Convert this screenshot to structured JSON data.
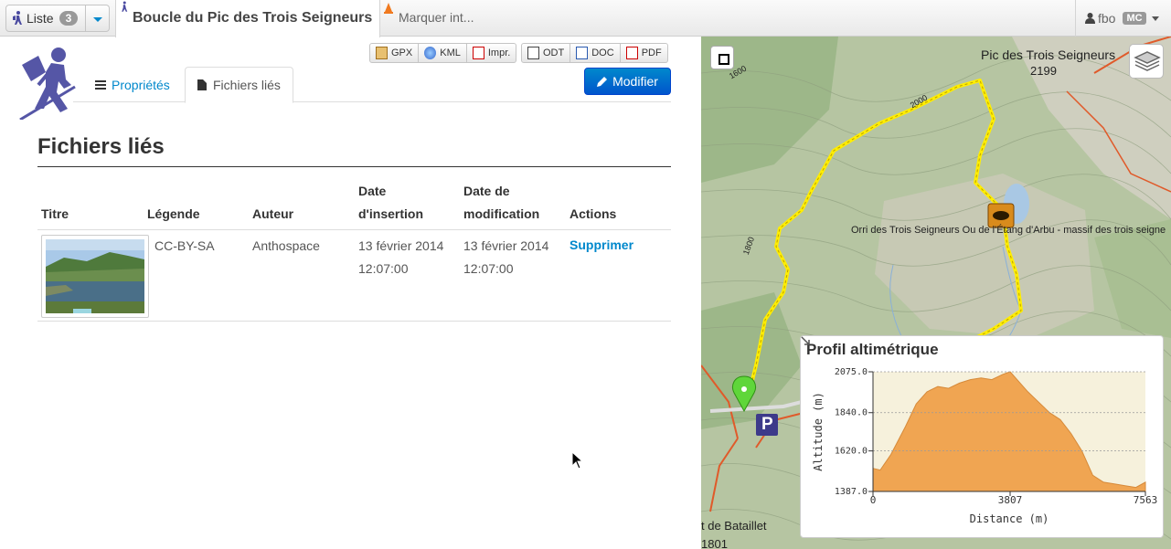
{
  "topbar": {
    "list_label": "Liste",
    "list_count": "3",
    "tab_title": "Boucle du Pic des Trois Seigneurs",
    "marker_text": "Marquer int...",
    "username": "fbo",
    "user_badge": "MC"
  },
  "exports": [
    {
      "label": "GPX",
      "icon": "gpx-icon"
    },
    {
      "label": "KML",
      "icon": "kml-icon"
    },
    {
      "label": "Impr.",
      "icon": "pdf-icon"
    },
    {
      "label": "ODT",
      "icon": "odt-icon"
    },
    {
      "label": "DOC",
      "icon": "doc-icon"
    },
    {
      "label": "PDF",
      "icon": "pdf-icon"
    }
  ],
  "tabs": {
    "properties": "Propriétés",
    "files": "Fichiers liés"
  },
  "modify_label": "Modifier",
  "section_title": "Fichiers liés",
  "table": {
    "headers": {
      "title": "Titre",
      "legend": "Légende",
      "author": "Auteur",
      "insert_l1": "Date",
      "insert_l2": "d'insertion",
      "modif_l1": "Date de",
      "modif_l2": "modification",
      "actions": "Actions"
    },
    "rows": [
      {
        "legend": "CC-BY-SA",
        "author": "Anthospace",
        "insert_date": "13 février 2014",
        "insert_time": "12:07:00",
        "modif_date": "13 février 2014",
        "modif_time": "12:07:00",
        "action": "Supprimer"
      }
    ]
  },
  "map": {
    "peak_name": "Pic des Trois Seigneurs",
    "peak_altitude": "2199",
    "lake_label": "Orri des Trois Seigneurs Ou de l'Étang d'Arbu - massif des trois seigne",
    "place_label": "t de Bataillet",
    "place_altitude": "1801",
    "contour_1600": "1600",
    "contour_2000": "2000",
    "contour_1800": "1800",
    "parking_label": "P",
    "track_color": "#ffee00"
  },
  "chart_data": {
    "type": "area",
    "title": "Profil altimétrique",
    "xlabel": "Distance (m)",
    "ylabel": "Altitude (m)",
    "xlim": [
      0,
      7563
    ],
    "ylim": [
      1387,
      2075
    ],
    "x_ticks": [
      "0",
      "3807",
      "7563"
    ],
    "y_ticks": [
      "2075.0",
      "1840.0",
      "1620.0",
      "1387.0"
    ],
    "fill_color": "#f0a552",
    "grid": true,
    "x": [
      0,
      200,
      500,
      900,
      1200,
      1500,
      1800,
      2100,
      2400,
      2700,
      3000,
      3300,
      3600,
      3807,
      4000,
      4300,
      4600,
      4900,
      5200,
      5500,
      5800,
      6100,
      6400,
      6700,
      7000,
      7300,
      7563
    ],
    "y": [
      1520,
      1510,
      1600,
      1760,
      1890,
      1960,
      1990,
      1980,
      2010,
      2030,
      2040,
      2030,
      2060,
      2075,
      2030,
      1960,
      1900,
      1840,
      1800,
      1720,
      1620,
      1480,
      1440,
      1430,
      1420,
      1410,
      1440
    ]
  }
}
